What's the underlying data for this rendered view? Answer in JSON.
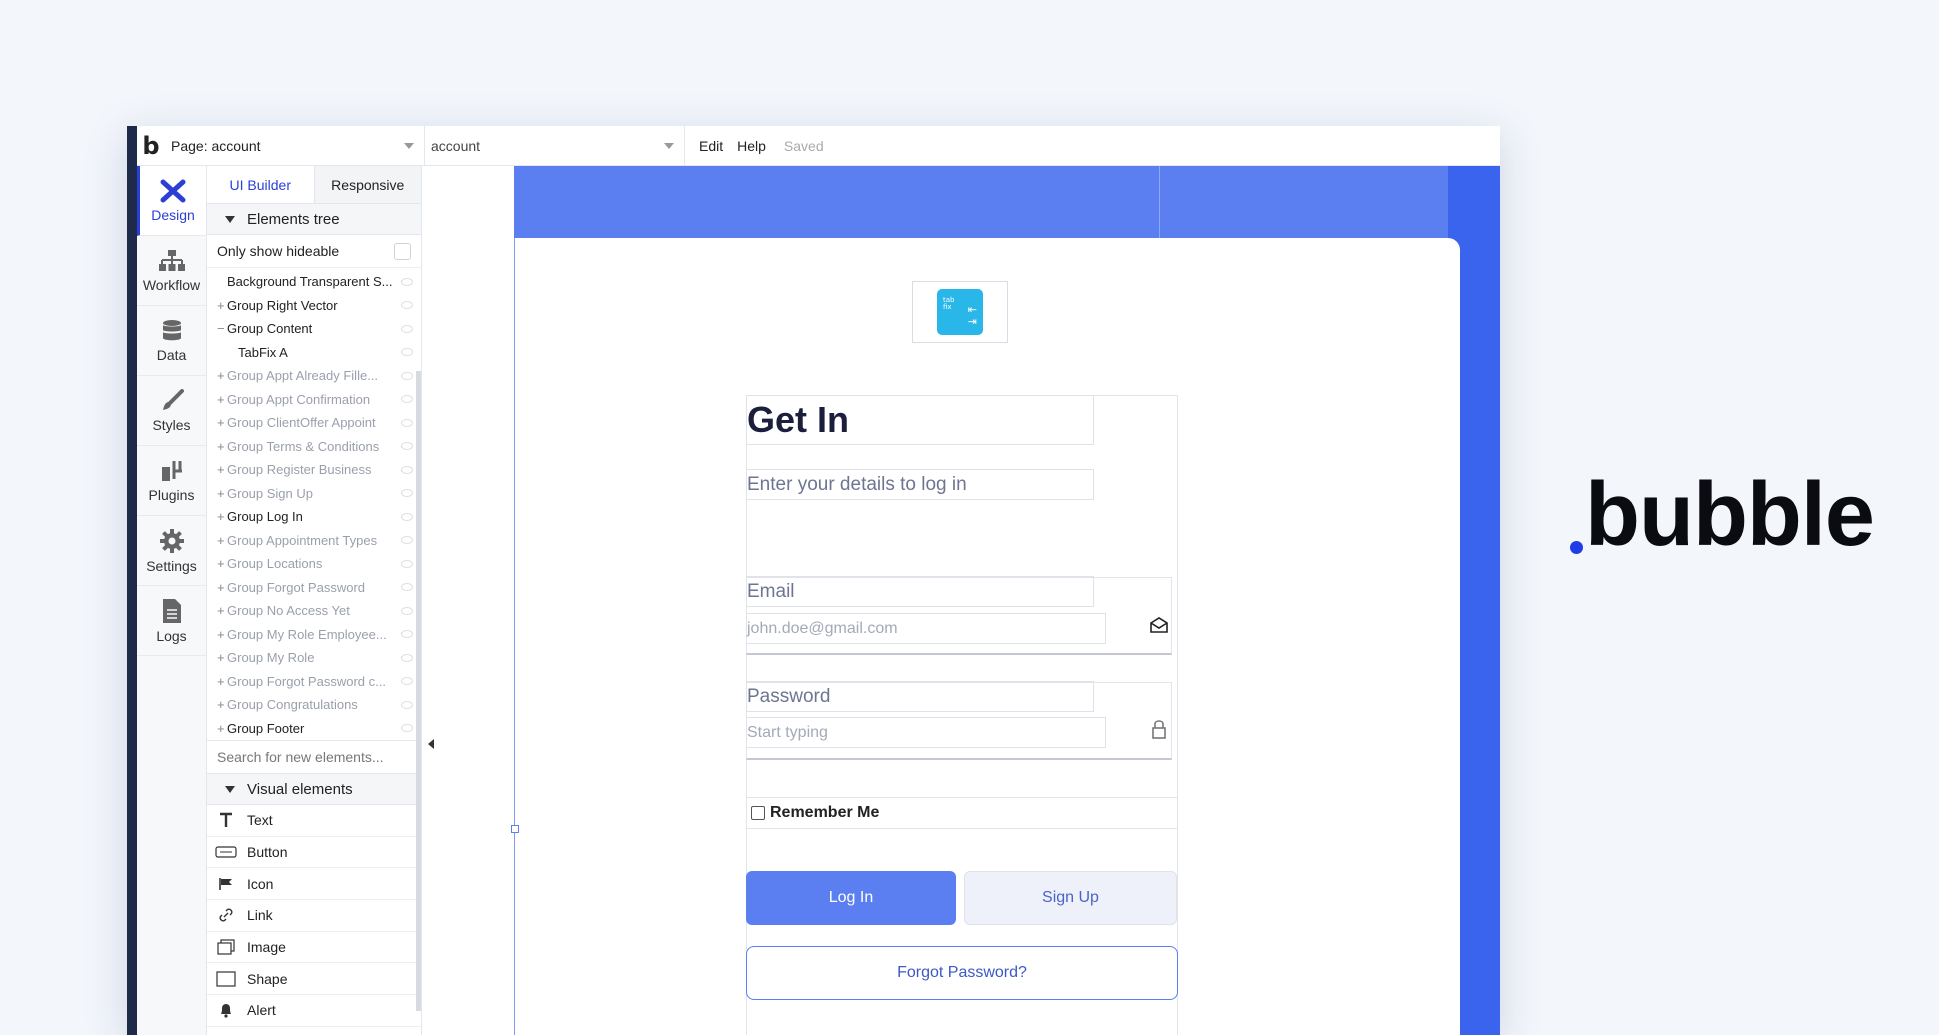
{
  "topbar": {
    "page_select": "Page: account",
    "page_name_select": "account",
    "menu_edit": "Edit",
    "menu_help": "Help",
    "status": "Saved"
  },
  "rail": {
    "items": [
      {
        "label": "Design",
        "icon": "design-icon"
      },
      {
        "label": "Workflow",
        "icon": "workflow-icon"
      },
      {
        "label": "Data",
        "icon": "database-icon"
      },
      {
        "label": "Styles",
        "icon": "brush-icon"
      },
      {
        "label": "Plugins",
        "icon": "plug-icon"
      },
      {
        "label": "Settings",
        "icon": "gear-icon"
      },
      {
        "label": "Logs",
        "icon": "document-icon"
      }
    ]
  },
  "panel": {
    "tab_ui_builder": "UI Builder",
    "tab_responsive": "Responsive",
    "elements_tree_title": "Elements tree",
    "only_show_hideable": "Only show hideable",
    "tree": [
      {
        "label": "Background Transparent S...",
        "prefix": "",
        "muted": false
      },
      {
        "label": "Group Right Vector",
        "prefix": "+",
        "muted": false
      },
      {
        "label": "Group Content",
        "prefix": "−",
        "muted": false
      },
      {
        "label": "TabFix A",
        "prefix": "",
        "muted": false
      },
      {
        "label": "Group Appt Already Fille...",
        "prefix": "+",
        "muted": true
      },
      {
        "label": "Group Appt Confirmation",
        "prefix": "+",
        "muted": true
      },
      {
        "label": "Group ClientOffer Appoint",
        "prefix": "+",
        "muted": true
      },
      {
        "label": "Group Terms & Conditions",
        "prefix": "+",
        "muted": true
      },
      {
        "label": "Group Register Business",
        "prefix": "+",
        "muted": true
      },
      {
        "label": "Group Sign Up",
        "prefix": "+",
        "muted": true
      },
      {
        "label": "Group Log In",
        "prefix": "+",
        "muted": false
      },
      {
        "label": "Group Appointment Types",
        "prefix": "+",
        "muted": true
      },
      {
        "label": "Group Locations",
        "prefix": "+",
        "muted": true
      },
      {
        "label": "Group Forgot Password",
        "prefix": "+",
        "muted": true
      },
      {
        "label": "Group No Access Yet",
        "prefix": "+",
        "muted": true
      },
      {
        "label": "Group My Role Employee...",
        "prefix": "+",
        "muted": true
      },
      {
        "label": "Group My Role",
        "prefix": "+",
        "muted": true
      },
      {
        "label": "Group Forgot Password c...",
        "prefix": "+",
        "muted": true
      },
      {
        "label": "Group Congratulations",
        "prefix": "+",
        "muted": true
      },
      {
        "label": "Group Footer",
        "prefix": "+",
        "muted": false
      }
    ],
    "search_placeholder": "Search for new elements...",
    "visual_elements_title": "Visual elements",
    "visual_elements": [
      {
        "label": "Text",
        "icon": "text-icon"
      },
      {
        "label": "Button",
        "icon": "button-icon"
      },
      {
        "label": "Icon",
        "icon": "flag-icon"
      },
      {
        "label": "Link",
        "icon": "link-icon"
      },
      {
        "label": "Image",
        "icon": "image-icon"
      },
      {
        "label": "Shape",
        "icon": "shape-icon"
      },
      {
        "label": "Alert",
        "icon": "bell-icon"
      }
    ]
  },
  "canvas": {
    "logo_text": "tab fix",
    "title": "Get In",
    "subtitle": "Enter your details to log in",
    "email_label": "Email",
    "email_placeholder": "john.doe@gmail.com",
    "password_label": "Password",
    "password_placeholder": "Start typing",
    "remember_me": "Remember Me",
    "login_button": "Log In",
    "signup_button": "Sign Up",
    "forgot_button": "Forgot Password?"
  },
  "brand": {
    "name": "bubble"
  },
  "colors": {
    "accent": "#5b7ff0",
    "accent_dark": "#3a64ee",
    "brand_dot": "#1f3ee6",
    "logo_tile": "#29b6e9"
  }
}
